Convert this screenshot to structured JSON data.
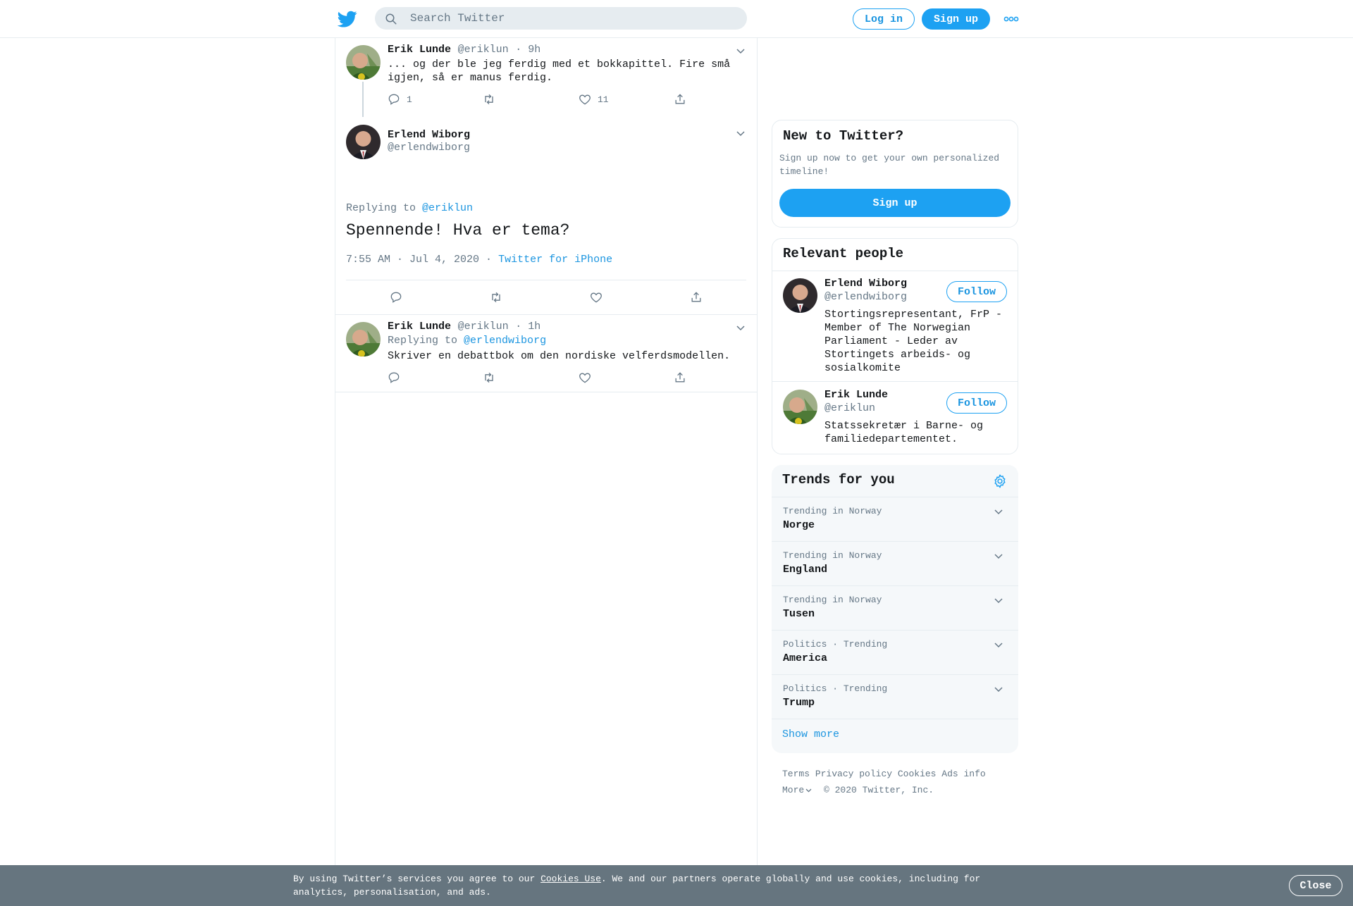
{
  "topbar": {
    "logo": "twitter-bird-icon",
    "search_placeholder": "Search Twitter",
    "login_label": "Log in",
    "signup_label": "Sign up",
    "more_icon": "more-dots-icon"
  },
  "thread": {
    "tweet1": {
      "name": "Erik Lunde",
      "handle": "@eriklun",
      "time": "· 9h",
      "text": "... og der ble jeg ferdig med et bokkapittel. Fire små igjen, så er manus ferdig.",
      "replies": "1",
      "likes": "11"
    },
    "focus": {
      "name": "Erlend Wiborg",
      "handle": "@erlendwiborg",
      "replying_prefix": "Replying to",
      "replying_to": "@eriklun",
      "text": "Spennende! Hva er tema?",
      "timestamp": "7:55 AM · Jul 4, 2020",
      "source_sep": "·",
      "source": "Twitter for iPhone"
    },
    "tweet3": {
      "name": "Erik Lunde",
      "handle": "@eriklun",
      "time": "· 1h",
      "replying_prefix": "Replying to",
      "replying_to": "@erlendwiborg",
      "text": "Skriver en debattbok om den nordiske velferdsmodellen."
    }
  },
  "sidebar": {
    "new_to_twitter": {
      "title": "New to Twitter?",
      "subtitle": "Sign up now to get your own personalized timeline!",
      "signup_label": "Sign up"
    },
    "relevant": {
      "title": "Relevant people",
      "people": [
        {
          "name": "Erlend Wiborg",
          "handle": "@erlendwiborg",
          "bio": "Stortingsrepresentant, FrP - Member of The Norwegian Parliament - Leder av Stortingets arbeids- og sosialkomite",
          "follow_label": "Follow"
        },
        {
          "name": "Erik Lunde",
          "handle": "@eriklun",
          "bio": "Statssekretær i Barne- og familiedepartementet.",
          "follow_label": "Follow"
        }
      ]
    },
    "trends": {
      "title": "Trends for you",
      "items": [
        {
          "context": "Trending in Norway",
          "name": "Norge"
        },
        {
          "context": "Trending in Norway",
          "name": "England"
        },
        {
          "context": "Trending in Norway",
          "name": "Tusen"
        },
        {
          "context": "Politics · Trending",
          "name": "America"
        },
        {
          "context": "Politics · Trending",
          "name": "Trump"
        }
      ],
      "show_more": "Show more"
    },
    "footer": {
      "terms": "Terms",
      "privacy": "Privacy policy",
      "cookies": "Cookies",
      "ads": "Ads info",
      "more": "More",
      "copyright": "© 2020 Twitter, Inc."
    }
  },
  "cookiebar": {
    "text_before": "By using Twitter’s services you agree to our ",
    "link": "Cookies Use",
    "text_after": ". We and our partners operate globally and use cookies, including for analytics, personalisation, and ads.",
    "close_label": "Close"
  },
  "colors": {
    "accent": "#1da1f2",
    "link": "#1b95e0",
    "secondary_text": "#657786",
    "cookie_bar": "#66757f"
  }
}
